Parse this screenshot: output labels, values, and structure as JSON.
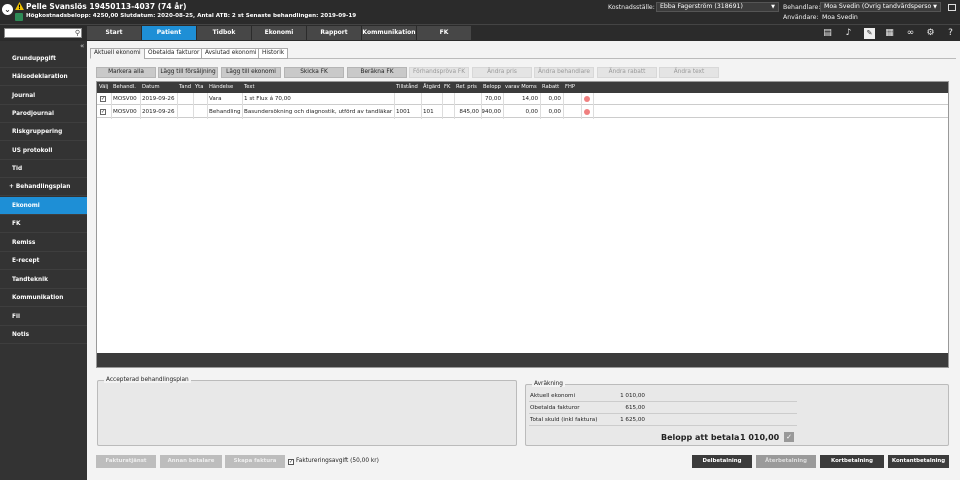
{
  "header": {
    "patient_name": "Pelle Svanslös 19450113-4037 (74 år)",
    "patient_info": "Högkostnadsbelopp: 4250,00 Slutdatum: 2020-08-25, Antal ATB: 2 st Senaste behandlingen: 2019-09-19",
    "cost_center_label": "Kostnadsställe:",
    "cost_center_value": "Ebba Fagerström (318691)",
    "practitioner_label": "Behandlare:",
    "practitioner_value": "Moa Svedin (Övrig tandvårdsperso",
    "user_label": "Användare:",
    "user_value": "Moa Svedin"
  },
  "nav": {
    "search_placeholder": "",
    "tabs": [
      "Start",
      "Patient",
      "Tidbok",
      "Ekonomi",
      "Rapport",
      "Kommunikation",
      "FK"
    ]
  },
  "sidebar": {
    "items": [
      "Grunduppgift",
      "Hälsodeklaration",
      "Journal",
      "Parodjournal",
      "Riskgruppering",
      "US protokoll",
      "Tid",
      "Behandlingsplan",
      "Ekonomi",
      "FK",
      "Remiss",
      "E-recept",
      "Tandteknik",
      "Kommunikation",
      "Fil",
      "Notis"
    ],
    "expand_marker": "+"
  },
  "subtabs": [
    "Aktuell ekonomi",
    "Obetalda fakturor",
    "Avslutad ekonomi",
    "Historik"
  ],
  "actions": [
    "Markera alla",
    "Lägg till försäljning",
    "Lägg till ekonomi",
    "Skicka FK",
    "Beräkna FK",
    "Förhandspröva FK",
    "Ändra pris",
    "Ändra behandlare",
    "Ändra rabatt",
    "Ändra text"
  ],
  "table": {
    "columns": [
      "Välj",
      "Behandl.",
      "Datum",
      "Tand",
      "Yta",
      "Händelse",
      "Text",
      "Tillstånd",
      "Åtgärd",
      "FK",
      "Ref. pris",
      "Belopp",
      "varav Moms",
      "Rabatt",
      "FHP"
    ],
    "rows": [
      {
        "checked": "✓",
        "behandl": "MOSV00",
        "datum": "2019-09-26",
        "tand": "",
        "yta": "",
        "handelse": "Vara",
        "text": "1 st Flux á 70,00",
        "tillstand": "",
        "atgard": "",
        "fk": "",
        "ref_pris": "",
        "belopp": "70,00",
        "moms": "14,00",
        "rabatt": "0,00",
        "fhp": ""
      },
      {
        "checked": "✓",
        "behandl": "MOSV00",
        "datum": "2019-09-26",
        "tand": "",
        "yta": "",
        "handelse": "Behandling",
        "text": "Basundersökning och diagnostik, utförd av tandläkar",
        "tillstand": "1001",
        "atgard": "101",
        "fk": "",
        "ref_pris": "845,00",
        "belopp": "940,00",
        "moms": "0,00",
        "rabatt": "0,00",
        "fhp": ""
      }
    ]
  },
  "accepted_plan": {
    "title": "Accepterad behandlingsplan"
  },
  "summary": {
    "title": "Avräkning",
    "rows": [
      {
        "label": "Aktuell ekonomi",
        "value": "1 010,00"
      },
      {
        "label": "Obetalda fakturor",
        "value": "615,00"
      },
      {
        "label": "Total skuld (inkl faktura)",
        "value": "1 625,00"
      }
    ],
    "total_label": "Belopp att betala",
    "total_value": "1 010,00"
  },
  "footer": {
    "left_buttons": [
      "Fakturatjänst",
      "Annan betalare",
      "Skapa faktura"
    ],
    "fee_checkbox": "✓",
    "fee_label": "Faktureringsavgift (50,00 kr)",
    "right_buttons": [
      "Delbetalning",
      "Återbetalning",
      "Kortbetalning",
      "Kontantbetalning"
    ]
  }
}
